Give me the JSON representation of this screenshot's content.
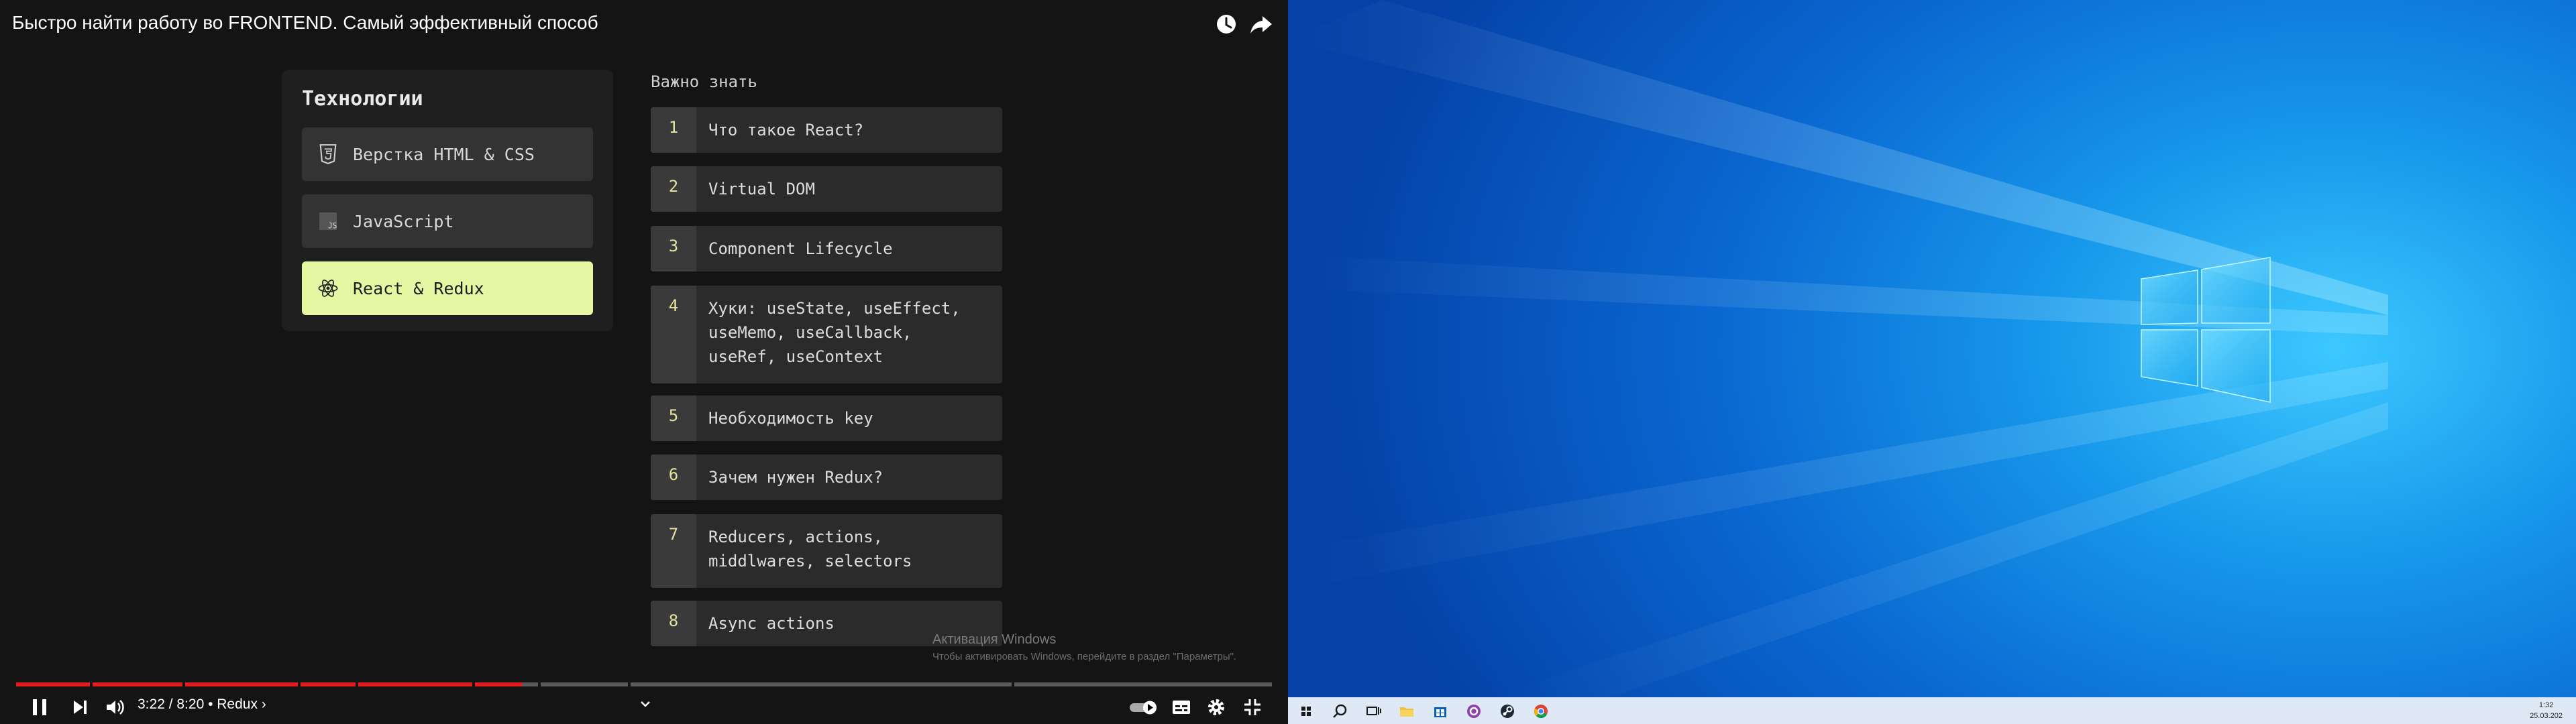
{
  "video": {
    "title": "Быстро найти работу во FRONTEND. Самый эффективный способ",
    "tech_panel": {
      "title": "Технологии",
      "items": [
        {
          "label": "Верстка HTML & CSS",
          "icon": "html5-icon",
          "active": false
        },
        {
          "label": "JavaScript",
          "icon": "js-icon",
          "active": false
        },
        {
          "label": "React & Redux",
          "icon": "react-icon",
          "active": true
        }
      ]
    },
    "important": {
      "title": "Важно знать",
      "items": [
        {
          "num": "1",
          "text": "Что такое React?"
        },
        {
          "num": "2",
          "text": "Virtual DOM"
        },
        {
          "num": "3",
          "text": "Component Lifecycle"
        },
        {
          "num": "4",
          "text": "Хуки: useState, useEffect,\nuseMemo, useCallback,\nuseRef, useContext"
        },
        {
          "num": "5",
          "text": "Необходимость key"
        },
        {
          "num": "6",
          "text": "Зачем нужен Redux?"
        },
        {
          "num": "7",
          "text": "Reducers, actions,\nmiddlwares, selectors"
        },
        {
          "num": "8",
          "text": "Async actions"
        }
      ]
    },
    "activation": {
      "title": "Активация Windows",
      "subtitle": "Чтобы активировать Windows, перейдите в раздел \"Параметры\"."
    },
    "player": {
      "time_chapter": "3:22 / 8:20 • Redux ›",
      "progress_fraction": 0.403,
      "accent_color": "#e21d1d"
    }
  },
  "taskbar": {
    "time": "1:32",
    "date": "25.03.202"
  }
}
